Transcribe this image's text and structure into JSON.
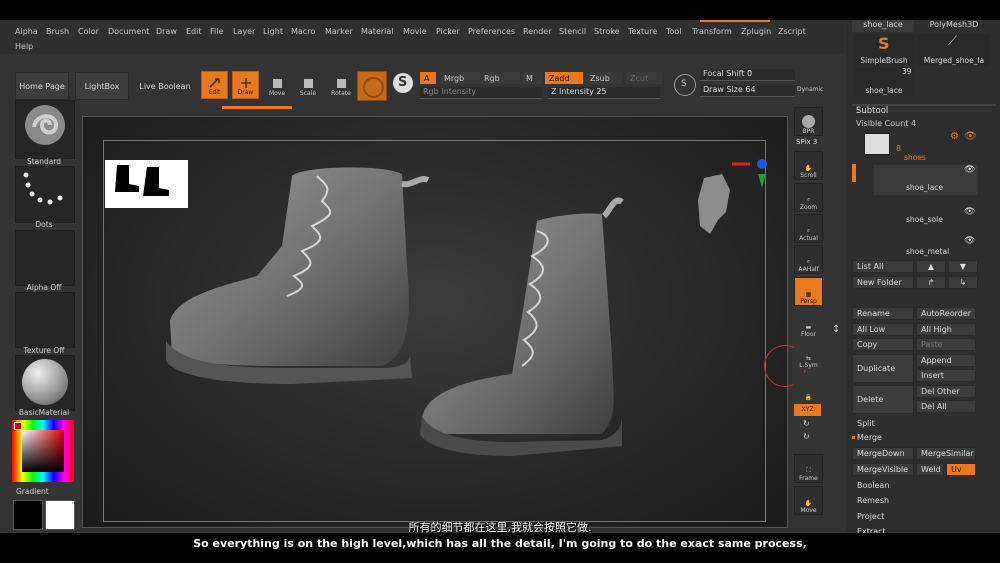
{
  "menu": [
    "Alpha",
    "Brush",
    "Color",
    "Document",
    "Draw",
    "Edit",
    "File",
    "Layer",
    "Light",
    "Macro",
    "Marker",
    "Material",
    "Movie",
    "Picker",
    "Preferences",
    "Render",
    "Stencil",
    "Stroke",
    "Texture",
    "Tool",
    "Transform",
    "Zplugin",
    "Zscript",
    "Help"
  ],
  "toolbar": {
    "home_page": "Home Page",
    "lightbox": "LightBox",
    "live_boolean": "Live Boolean",
    "edit": "Edit",
    "draw": "Draw",
    "move": "Move",
    "scale": "Scale",
    "rotate": "Rotate",
    "a_label": "A",
    "mrgb": "Mrgb",
    "rgb": "Rgb",
    "m": "M",
    "zadd": "Zadd",
    "zsub": "Zsub",
    "zcut": "Zcut",
    "rgb_intensity": "Rgb Intensity",
    "z_intensity": "Z Intensity 25",
    "focal_shift": "Focal Shift 0",
    "draw_size": "Draw Size 64",
    "dynamic": "Dynamic"
  },
  "left_shelf": {
    "brush": "Standard",
    "stroke": "Dots",
    "alpha": "Alpha Off",
    "texture": "Texture Off",
    "material": "BasicMaterial",
    "gradient": "Gradient"
  },
  "right_tools": {
    "bpr": "BPR",
    "spix": "SPix 3",
    "scroll": "Scroll",
    "zoom": "Zoom",
    "actual": "Actual",
    "aahalf": "AAHalf",
    "persp": "Persp",
    "floor": "Floor",
    "lsym": "L.Sym",
    "xyz": "XYZ",
    "frame": "Frame",
    "move": "Move"
  },
  "panel": {
    "tool_top_left": "shoe_lace",
    "tool_top_right": "PolyMesh3D",
    "simplebrush": "SimpleBrush",
    "merged": "Merged_shoe_la",
    "count": "39",
    "shoe_lace_thumb": "shoe_lace",
    "subtool_title": "Subtool",
    "visible_count": "Visible Count 4",
    "subtool_number": "8",
    "subtools": [
      "shoes",
      "shoe_lace",
      "shoe_sole",
      "shoe_metal"
    ],
    "list_all": "List All",
    "new_folder": "New Folder",
    "rename": "Rename",
    "autoreorder": "AutoReorder",
    "all_low": "All Low",
    "all_high": "All High",
    "copy": "Copy",
    "paste": "Paste",
    "duplicate": "Duplicate",
    "append": "Append",
    "insert": "Insert",
    "delete": "Delete",
    "del_other": "Del Other",
    "del_all": "Del All",
    "split": "Split",
    "merge": "Merge",
    "merge_down": "MergeDown",
    "merge_similar": "MergeSimilar",
    "merge_visible": "MergeVisible",
    "weld": "Weld",
    "uv": "Uv",
    "boolean": "Boolean",
    "remesh": "Remesh",
    "project": "Project",
    "extract": "Extract"
  },
  "subtitles": {
    "cn": "所有的细节都在这里,我就会按照它做.",
    "en": "So everything is on the high level,which has all the detail, I'm going to do the exact same process,"
  },
  "colors": {
    "accent": "#e87a1d",
    "background": "#343434",
    "viewport": "#262626"
  }
}
